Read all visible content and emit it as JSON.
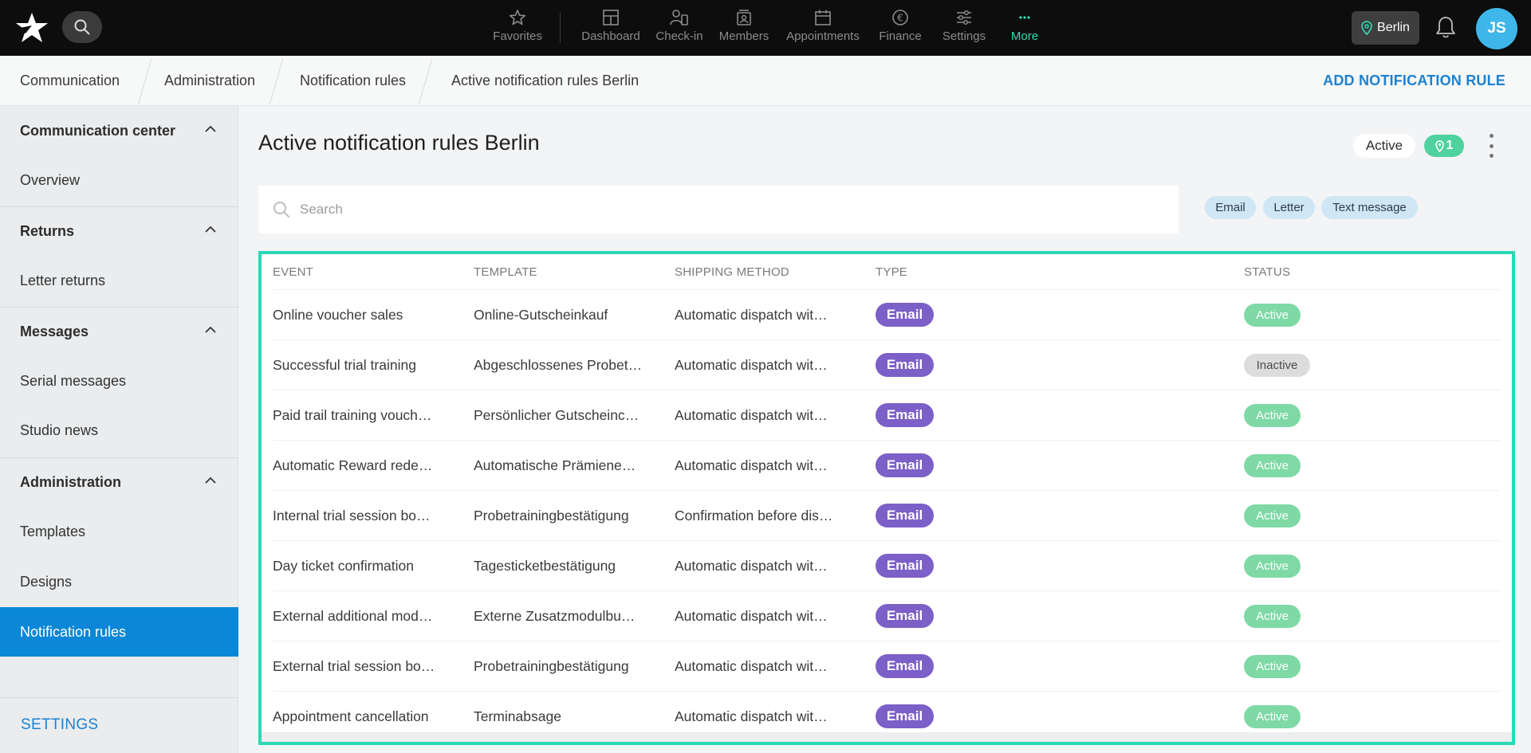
{
  "topbar": {
    "nav": [
      {
        "label": "Favorites",
        "icon": "star-icon"
      },
      {
        "label": "Dashboard",
        "icon": "dashboard-icon"
      },
      {
        "label": "Check-in",
        "icon": "check-in-icon"
      },
      {
        "label": "Members",
        "icon": "members-icon"
      },
      {
        "label": "Appointments",
        "icon": "calendar-icon"
      },
      {
        "label": "Finance",
        "icon": "euro-icon"
      },
      {
        "label": "Settings",
        "icon": "sliders-icon"
      },
      {
        "label": "More",
        "icon": "dots-icon"
      }
    ],
    "location": "Berlin",
    "avatar_initials": "JS"
  },
  "breadcrumb": [
    "Communication",
    "Administration",
    "Notification rules",
    "Active notification rules Berlin"
  ],
  "add_rule_label": "ADD NOTIFICATION RULE",
  "sidebar": {
    "sections": [
      {
        "title": "Communication center",
        "items": [
          "Overview"
        ]
      },
      {
        "title": "Returns",
        "items": [
          "Letter returns"
        ]
      },
      {
        "title": "Messages",
        "items": [
          "Serial messages",
          "Studio news"
        ]
      },
      {
        "title": "Administration",
        "items": [
          "Templates",
          "Designs",
          "Notification rules"
        ]
      }
    ],
    "active_item": "Notification rules",
    "settings_label": "SETTINGS"
  },
  "main": {
    "title": "Active notification rules Berlin",
    "status_filter": "Active",
    "location_count": "1",
    "search_placeholder": "Search",
    "chips": [
      "Email",
      "Letter",
      "Text message"
    ]
  },
  "table": {
    "headers": [
      "EVENT",
      "TEMPLATE",
      "SHIPPING METHOD",
      "TYPE",
      "STATUS"
    ],
    "rows": [
      {
        "event": "Online voucher sales",
        "template": "Online-Gutscheinkauf",
        "shipping": "Automatic dispatch wit…",
        "type": "Email",
        "status": "Active"
      },
      {
        "event": "Successful trial training",
        "template": "Abgeschlossenes Probet…",
        "shipping": "Automatic dispatch wit…",
        "type": "Email",
        "status": "Inactive"
      },
      {
        "event": "Paid trail training vouch…",
        "template": "Persönlicher Gutscheinc…",
        "shipping": "Automatic dispatch wit…",
        "type": "Email",
        "status": "Active"
      },
      {
        "event": "Automatic Reward rede…",
        "template": "Automatische Prämiene…",
        "shipping": "Automatic dispatch wit…",
        "type": "Email",
        "status": "Active"
      },
      {
        "event": "Internal trial session bo…",
        "template": "Probetrainingbestätigung",
        "shipping": "Confirmation before dis…",
        "type": "Email",
        "status": "Active"
      },
      {
        "event": "Day ticket confirmation",
        "template": "Tagesticketbestätigung",
        "shipping": "Automatic dispatch wit…",
        "type": "Email",
        "status": "Active"
      },
      {
        "event": "External additional mod…",
        "template": "Externe Zusatzmodulbu…",
        "shipping": "Automatic dispatch wit…",
        "type": "Email",
        "status": "Active"
      },
      {
        "event": "External trial session bo…",
        "template": "Probetrainingbestätigung",
        "shipping": "Automatic dispatch wit…",
        "type": "Email",
        "status": "Active"
      },
      {
        "event": "Appointment cancellation",
        "template": "Terminabsage",
        "shipping": "Automatic dispatch wit…",
        "type": "Email",
        "status": "Active"
      }
    ]
  },
  "colors": {
    "accent_blue": "#1b82d1",
    "sidebar_active": "#0a87d6",
    "more_green": "#2fe0b6",
    "email_purple": "#7c5fc7",
    "active_green": "#7ed9a5",
    "frame_teal": "#2bd9b4"
  }
}
